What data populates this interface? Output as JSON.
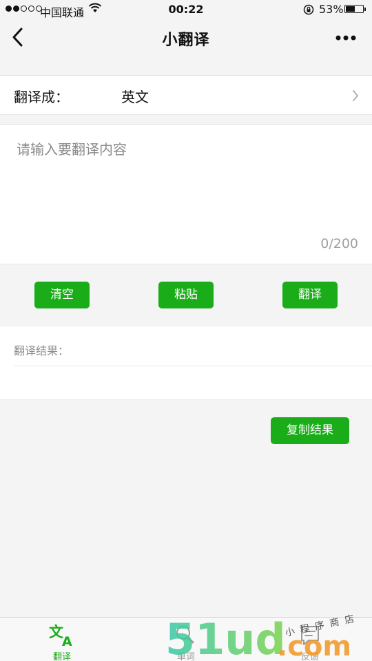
{
  "status_bar": {
    "carrier": "中国联通",
    "time": "00:22",
    "battery_percent": "53%",
    "battery_level": 0.53,
    "signal_bars_filled": 2,
    "signal_bars_total": 5
  },
  "nav": {
    "title": "小翻译",
    "back_icon": "chevron-left-icon",
    "more_icon": "more-dots-icon"
  },
  "language": {
    "label": "翻译成：",
    "value": "英文"
  },
  "input": {
    "placeholder": "请输入要翻译内容",
    "value": "",
    "counter": "0/200"
  },
  "actions": {
    "clear_label": "清空",
    "paste_label": "粘贴",
    "translate_label": "翻译"
  },
  "result": {
    "label": "翻译结果：",
    "text": ""
  },
  "copy_button_label": "复制结果",
  "tabs": [
    {
      "label": "翻译",
      "icon": "translate-icon",
      "active": true
    },
    {
      "label": "单词",
      "icon": "word-icon",
      "active": false
    },
    {
      "label": "反馈",
      "icon": "feedback-icon",
      "active": false
    }
  ],
  "watermark": {
    "brand": "51ud",
    "domain": ".com",
    "tagline": "小程序商店"
  },
  "colors": {
    "accent": "#1aad19",
    "background": "#f4f4f4",
    "inactive_tab": "#9a9a9a"
  }
}
